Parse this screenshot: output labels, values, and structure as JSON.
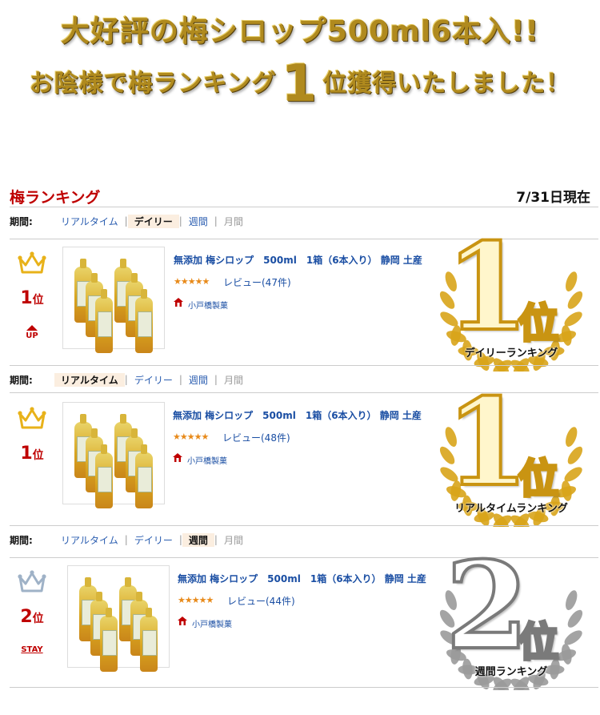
{
  "banner": {
    "headline_1": "大好評の梅シロップ500ml6本入!!",
    "headline_2_pre": "お陰様で梅ランキング",
    "headline_2_rank": "1",
    "headline_2_post": "位獲得いたしました！"
  },
  "ranking": {
    "title": "梅ランキング",
    "as_of": "7/31日現在",
    "period_label": "期間:",
    "sections": [
      {
        "period_options": [
          "リアルタイム",
          "デイリー",
          "週間",
          "月間"
        ],
        "active_option": "デイリー",
        "rank": "1",
        "rank_unit": "位",
        "trend": "UP",
        "product_name": "無添加 梅シロップ　500ml　1箱（6本入り） 静岡 土産",
        "stars": "★★★★★",
        "review": "レビュー(47件)",
        "shop": "小戸橋製菓",
        "badge_number": "1",
        "badge_unit": "位",
        "badge_caption": "デイリーランキング",
        "badge_style": "gold"
      },
      {
        "period_options": [
          "リアルタイム",
          "デイリー",
          "週間",
          "月間"
        ],
        "active_option": "リアルタイム",
        "rank": "1",
        "rank_unit": "位",
        "trend": "",
        "product_name": "無添加 梅シロップ　500ml　1箱（6本入り） 静岡 土産",
        "stars": "★★★★★",
        "review": "レビュー(48件)",
        "shop": "小戸橋製菓",
        "badge_number": "1",
        "badge_unit": "位",
        "badge_caption": "リアルタイムランキング",
        "badge_style": "gold"
      },
      {
        "period_options": [
          "リアルタイム",
          "デイリー",
          "週間",
          "月間"
        ],
        "active_option": "週間",
        "rank": "2",
        "rank_unit": "位",
        "trend": "STAY",
        "product_name": "無添加 梅シロップ　500ml　1箱（6本入り） 静岡 土産",
        "stars": "★★★★★",
        "review": "レビュー(44件)",
        "shop": "小戸橋製菓",
        "badge_number": "2",
        "badge_unit": "位",
        "badge_caption": "週間ランキング",
        "badge_style": "silver"
      }
    ]
  },
  "colors": {
    "accent_red": "#bf0000",
    "link_blue": "#1a4ea3",
    "gold": "#c99412",
    "silver": "#7a7a7a",
    "star_orange": "#e88a1a"
  }
}
